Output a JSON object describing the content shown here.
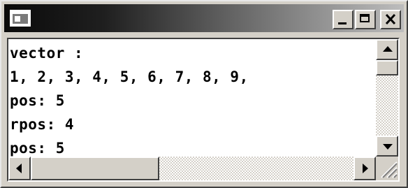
{
  "window": {
    "title": "",
    "controls": {
      "minimize_icon": "minimize-icon",
      "maximize_icon": "maximize-icon",
      "close_icon": "close-icon"
    }
  },
  "console": {
    "lines": [
      "vector :",
      "1, 2, 3, 4, 5, 6, 7, 8, 9,",
      "pos: 5",
      "rpos: 4",
      "pos: 5"
    ]
  },
  "colors": {
    "titlebar_dark": "#0a0a0a",
    "titlebar_light": "#bdbdbd",
    "face": "#d4d0c8",
    "console_bg": "#ffffff",
    "console_text": "#000000"
  }
}
